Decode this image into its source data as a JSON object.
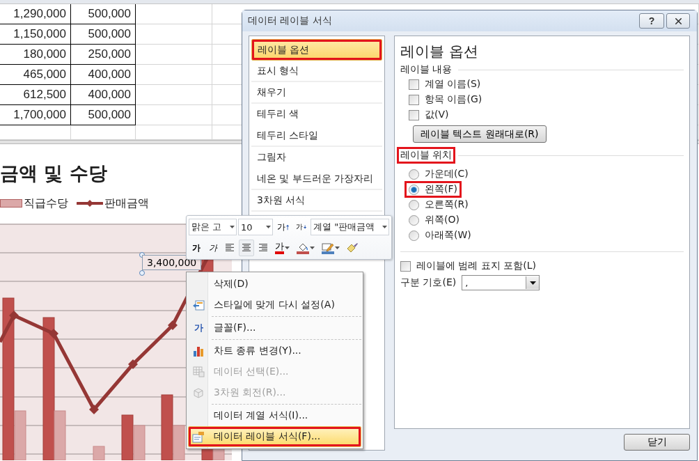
{
  "sheet": {
    "rows": [
      [
        "1,290,000",
        "500,000"
      ],
      [
        "1,150,000",
        "500,000"
      ],
      [
        "180,000",
        "250,000"
      ],
      [
        "465,000",
        "400,000"
      ],
      [
        "612,500",
        "400,000"
      ],
      [
        "1,700,000",
        "500,000"
      ]
    ]
  },
  "chart": {
    "title": "금액 및 수당",
    "legend": [
      {
        "kind": "bar",
        "label": "직급수당"
      },
      {
        "kind": "line",
        "label": "판매금액"
      }
    ],
    "data_label": {
      "text": "3,400,000",
      "selected": true
    }
  },
  "mini_toolbar": {
    "font": "맑은 고",
    "size": "10",
    "grow_label": "가",
    "shrink_label": "가",
    "series": "계열 \"판매금액",
    "bold_label": "가",
    "italic_label": "가",
    "alignments": [
      {
        "kind": "left",
        "selected": false
      },
      {
        "kind": "center",
        "selected": true
      },
      {
        "kind": "right",
        "selected": false
      }
    ],
    "font_color_label": "가"
  },
  "context_menu": {
    "items": [
      {
        "label": "삭제(D)",
        "kind": "none",
        "disabled": false,
        "highlighted": false,
        "annotated": false,
        "separator_before": false
      },
      {
        "label": "스타일에 맞게 다시 설정(A)",
        "kind": "reset",
        "disabled": false,
        "highlighted": false,
        "annotated": false,
        "separator_before": false
      },
      {
        "label": "글꼴(F)...",
        "kind": "text",
        "icon_text": "가",
        "disabled": false,
        "highlighted": false,
        "annotated": false,
        "separator_before": true
      },
      {
        "label": "차트 종류 변경(Y)...",
        "kind": "chart",
        "disabled": false,
        "highlighted": false,
        "annotated": false,
        "separator_before": true
      },
      {
        "label": "데이터 선택(E)...",
        "kind": "table",
        "disabled": true,
        "highlighted": false,
        "annotated": false,
        "separator_before": false
      },
      {
        "label": "3차원 회전(R)...",
        "kind": "cube",
        "disabled": true,
        "highlighted": false,
        "annotated": false,
        "separator_before": false
      },
      {
        "label": "데이터 계열 서식(I)...",
        "kind": "none",
        "disabled": false,
        "highlighted": false,
        "annotated": false,
        "separator_before": true
      },
      {
        "label": "데이터 레이블 서식(F)...",
        "kind": "label",
        "disabled": false,
        "highlighted": true,
        "annotated": true,
        "separator_before": false
      }
    ]
  },
  "dialog": {
    "title": "데이터 레이블 서식",
    "help_label": "?",
    "categories": [
      {
        "label": "레이블 옵션",
        "selected": true,
        "annotated": true,
        "divider_after": true
      },
      {
        "label": "표시 형식",
        "selected": false,
        "annotated": false,
        "divider_after": true
      },
      {
        "label": "채우기",
        "selected": false,
        "annotated": false,
        "divider_after": true
      },
      {
        "label": "테두리 색",
        "selected": false,
        "annotated": false,
        "divider_after": false
      },
      {
        "label": "테두리 스타일",
        "selected": false,
        "annotated": false,
        "divider_after": true
      },
      {
        "label": "그림자",
        "selected": false,
        "annotated": false,
        "divider_after": false
      },
      {
        "label": "네온 및 부드러운 가장자리",
        "selected": false,
        "annotated": false,
        "divider_after": true
      },
      {
        "label": "3차원 서식",
        "selected": false,
        "annotated": false,
        "divider_after": true
      }
    ],
    "heading": "레이블 옵션",
    "content_section": {
      "title": "레이블 내용",
      "checkboxes": [
        {
          "label": "계열 이름(S)",
          "checked": false
        },
        {
          "label": "항목 이름(G)",
          "checked": false
        },
        {
          "label": "값(V)",
          "checked": false
        }
      ],
      "reset_button": "레이블 텍스트 원래대로(R)"
    },
    "position_section": {
      "title": "레이블 위치",
      "annotated": true,
      "options": [
        {
          "label": "가운데(C)",
          "selected": false,
          "annotated": false
        },
        {
          "label": "왼쪽(F)",
          "selected": true,
          "annotated": true
        },
        {
          "label": "오른쪽(R)",
          "selected": false,
          "annotated": false
        },
        {
          "label": "위쪽(O)",
          "selected": false,
          "annotated": false
        },
        {
          "label": "아래쪽(W)",
          "selected": false,
          "annotated": false
        }
      ]
    },
    "legend_key": {
      "label": "레이블에 범례 표지 포함(L)",
      "checked": false
    },
    "separator": {
      "label": "구분 기호(E)",
      "value": ","
    },
    "close_button": "닫기"
  }
}
